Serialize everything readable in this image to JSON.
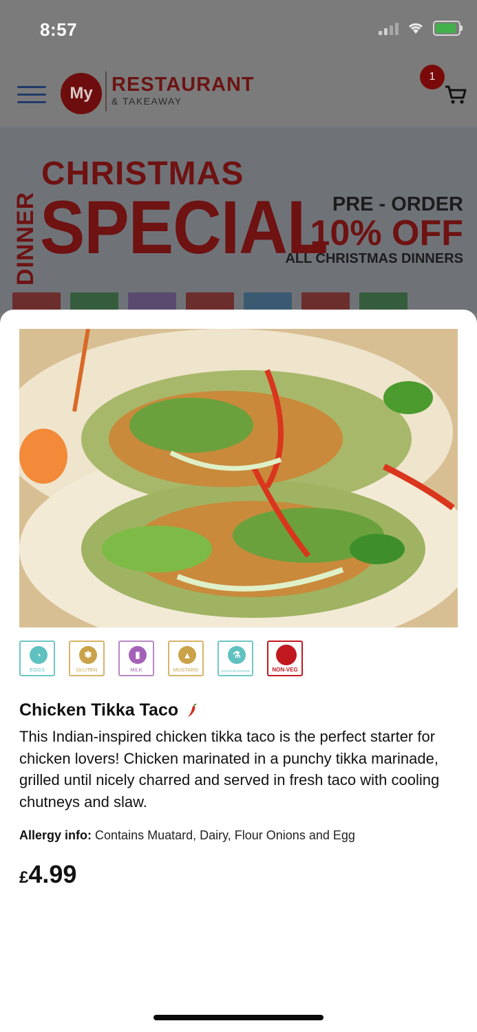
{
  "status_bar": {
    "time": "8:57"
  },
  "header": {
    "logo_mark": "My",
    "logo_title": "RESTAURANT",
    "logo_subtitle": "& TAKEAWAY",
    "cart_count": "1"
  },
  "banner": {
    "vertical": "DINNER",
    "line1": "CHRISTMAS",
    "line2": "SPECIAL",
    "preorder": "PRE - ORDER",
    "discount": "10% OFF",
    "subtitle": "ALL CHRISTMAS DINNERS"
  },
  "product": {
    "name": "Chicken Tikka Taco",
    "description": "This Indian-inspired chicken tikka taco is the perfect starter for chicken lovers! Chicken marinated in a punchy tikka marinade, grilled until nicely charred and served in fresh taco with cooling chutneys and slaw.",
    "allergy_label": "Allergy info:",
    "allergy_text": "Contains Muatard, Dairy, Flour Onions and Egg",
    "currency": "£",
    "price": "4.99",
    "allergens": [
      {
        "label": "EGGS",
        "color": "#5fc1c0",
        "icon": "egg-icon"
      },
      {
        "label": "GLUTEN",
        "color": "#c9a24a",
        "icon": "wheat-icon"
      },
      {
        "label": "MILK",
        "color": "#a461b8",
        "icon": "milk-bottle-icon"
      },
      {
        "label": "MUSTARD",
        "color": "#c9a24a",
        "icon": "mustard-icon"
      },
      {
        "label": "SULPHUR DIOXIDE",
        "color": "#5fc1c0",
        "icon": "flask-icon"
      },
      {
        "label": "NON-VEG",
        "color": "#c0181e",
        "icon": "non-veg-dot-icon"
      }
    ]
  }
}
